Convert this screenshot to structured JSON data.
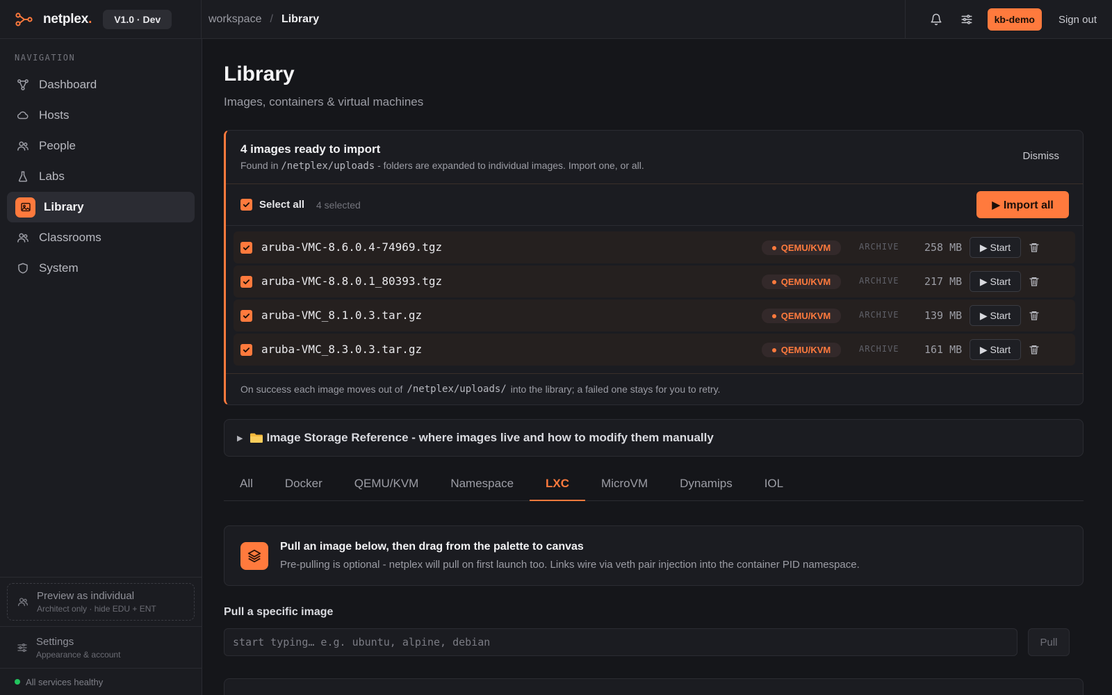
{
  "app": {
    "brand_name": "netplex",
    "brand_dot": ".",
    "version": "V1.0 · Dev",
    "accent": "#ff7a3d"
  },
  "breadcrumb": {
    "root": "workspace",
    "sep": "/",
    "current": "Library"
  },
  "header": {
    "icons": [
      "bell-icon",
      "sliders-icon"
    ],
    "user": "kb-demo",
    "signout": "Sign out"
  },
  "sidebar": {
    "heading": "NAVIGATION",
    "items": [
      {
        "label": "Dashboard",
        "icon": "nodes-icon"
      },
      {
        "label": "Hosts",
        "icon": "cloud-icon"
      },
      {
        "label": "People",
        "icon": "people-icon"
      },
      {
        "label": "Labs",
        "icon": "flask-icon"
      },
      {
        "label": "Library",
        "icon": "image-icon",
        "active": true
      },
      {
        "label": "Classrooms",
        "icon": "people-icon"
      },
      {
        "label": "System",
        "icon": "shield-icon"
      }
    ],
    "preview": {
      "title": "Preview as individual",
      "sub": "Architect only · hide EDU + ENT"
    },
    "settings": {
      "title": "Settings",
      "sub": "Appearance & account"
    },
    "status": "All services healthy"
  },
  "page": {
    "title": "Library",
    "subtitle": "Images, containers & virtual machines"
  },
  "import_card": {
    "title": "4 images ready to import",
    "desc_prefix": "Found in",
    "desc_path": "/netplex/uploads",
    "desc_suffix": "- folders are expanded to individual images. Import one, or all.",
    "dismiss": "Dismiss",
    "select_all": "Select all",
    "selected_count": "4 selected",
    "import_all": "▶ Import all",
    "files": [
      {
        "name": "aruba-VMC-8.6.0.4-74969.tgz",
        "type": "QEMU/KVM",
        "kind": "ARCHIVE",
        "size": "258 MB",
        "action": "▶ Start"
      },
      {
        "name": "aruba-VMC-8.8.0.1_80393.tgz",
        "type": "QEMU/KVM",
        "kind": "ARCHIVE",
        "size": "217 MB",
        "action": "▶ Start"
      },
      {
        "name": "aruba-VMC_8.1.0.3.tar.gz",
        "type": "QEMU/KVM",
        "kind": "ARCHIVE",
        "size": "139 MB",
        "action": "▶ Start"
      },
      {
        "name": "aruba-VMC_8.3.0.3.tar.gz",
        "type": "QEMU/KVM",
        "kind": "ARCHIVE",
        "size": "161 MB",
        "action": "▶ Start"
      }
    ],
    "foot_prefix": "On success each image moves out of",
    "foot_path": "/netplex/uploads/",
    "foot_suffix": "into the library; a failed one stays for you to retry."
  },
  "storage_ref": {
    "label": "Image Storage Reference - where images live and how to modify them manually"
  },
  "tabs": {
    "items": [
      "All",
      "Docker",
      "QEMU/KVM",
      "Namespace",
      "LXC",
      "MicroVM",
      "Dynamips",
      "IOL"
    ],
    "active": "LXC"
  },
  "info": {
    "icon": "layers-icon",
    "title": "Pull an image below, then drag from the palette to canvas",
    "desc": "Pre-pulling is optional - netplex will pull on first launch too. Links wire via veth pair injection into the container PID namespace."
  },
  "pull": {
    "label": "Pull a specific image",
    "placeholder": "start typing… e.g. ubuntu, alpine, debian",
    "button": "Pull"
  }
}
